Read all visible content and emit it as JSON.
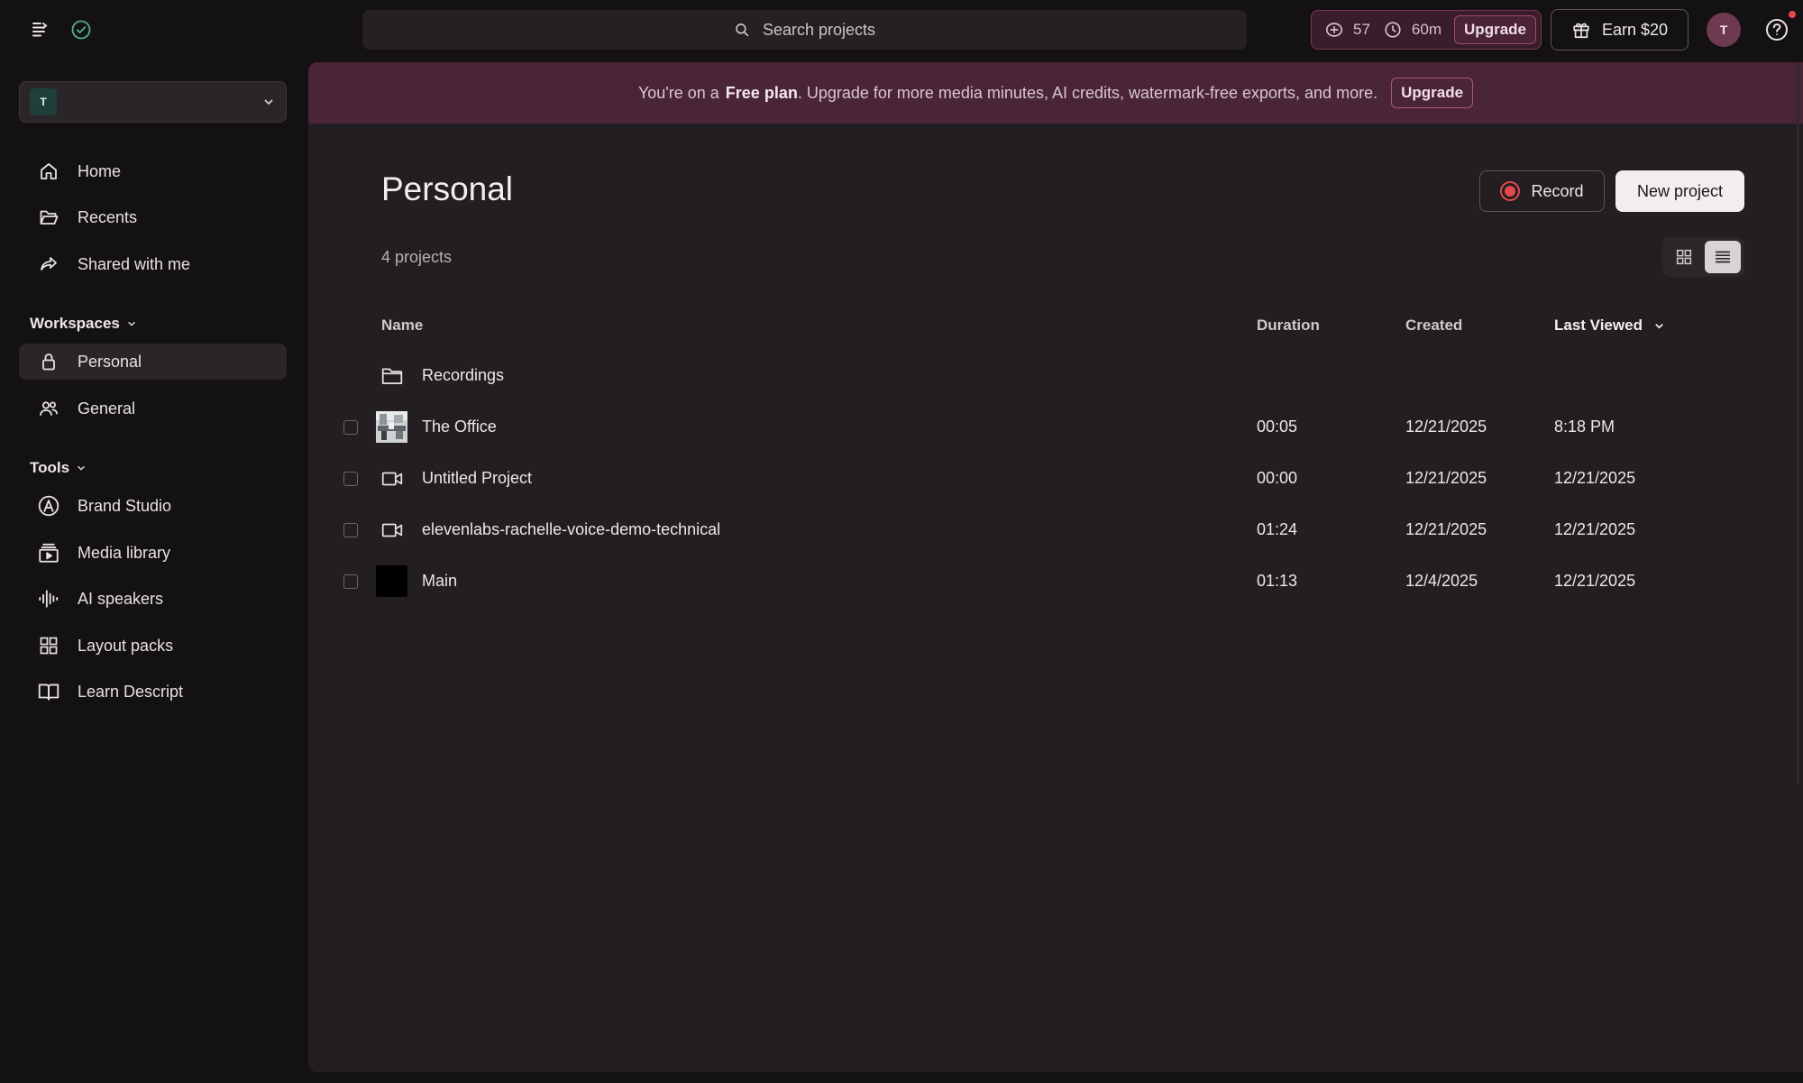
{
  "topbar": {
    "search_placeholder": "Search projects",
    "ai_credits": "57",
    "media_minutes": "60m",
    "upgrade_label": "Upgrade",
    "earn_label": "Earn $20",
    "avatar_initial": "T"
  },
  "sidebar": {
    "workspace_badge": "T",
    "nav": [
      {
        "label": "Home",
        "icon": "home-icon"
      },
      {
        "label": "Recents",
        "icon": "folder-open-icon"
      },
      {
        "label": "Shared with me",
        "icon": "share-icon"
      }
    ],
    "workspaces_heading": "Workspaces",
    "workspaces": [
      {
        "label": "Personal",
        "icon": "lock-icon",
        "active": true
      },
      {
        "label": "General",
        "icon": "users-icon",
        "active": false
      }
    ],
    "tools_heading": "Tools",
    "tools": [
      {
        "label": "Brand Studio",
        "icon": "brand-studio-icon"
      },
      {
        "label": "Media library",
        "icon": "media-library-icon"
      },
      {
        "label": "AI speakers",
        "icon": "waveform-icon"
      },
      {
        "label": "Layout packs",
        "icon": "grid-icon"
      },
      {
        "label": "Learn Descript",
        "icon": "book-icon"
      }
    ]
  },
  "banner": {
    "prefix": "You're on a",
    "plan": "Free plan",
    "suffix": ". Upgrade for more media minutes, AI credits, watermark-free exports, and more.",
    "button": "Upgrade"
  },
  "main": {
    "title": "Personal",
    "project_count": "4 projects",
    "record_label": "Record",
    "new_project_label": "New project",
    "columns": {
      "name": "Name",
      "duration": "Duration",
      "created": "Created",
      "last_viewed": "Last Viewed"
    },
    "rows": [
      {
        "name": "Recordings",
        "kind": "folder-icon",
        "duration": "",
        "created": "",
        "last_viewed": ""
      },
      {
        "name": "The Office",
        "kind": "thumbnail-image",
        "duration": "00:05",
        "created": "12/21/2025",
        "last_viewed": "8:18 PM"
      },
      {
        "name": "Untitled Project",
        "kind": "video-camera-icon",
        "duration": "00:00",
        "created": "12/21/2025",
        "last_viewed": "12/21/2025"
      },
      {
        "name": "elevenlabs-rachelle-voice-demo-technical",
        "kind": "video-camera-icon",
        "duration": "01:24",
        "created": "12/21/2025",
        "last_viewed": "12/21/2025"
      },
      {
        "name": "Main",
        "kind": "thumbnail-black",
        "duration": "01:13",
        "created": "12/4/2025",
        "last_viewed": "12/21/2025"
      }
    ]
  },
  "colors": {
    "background": "#141113",
    "panel": "#221e21",
    "banner": "#4a2537",
    "accent_red": "#e5484d"
  }
}
